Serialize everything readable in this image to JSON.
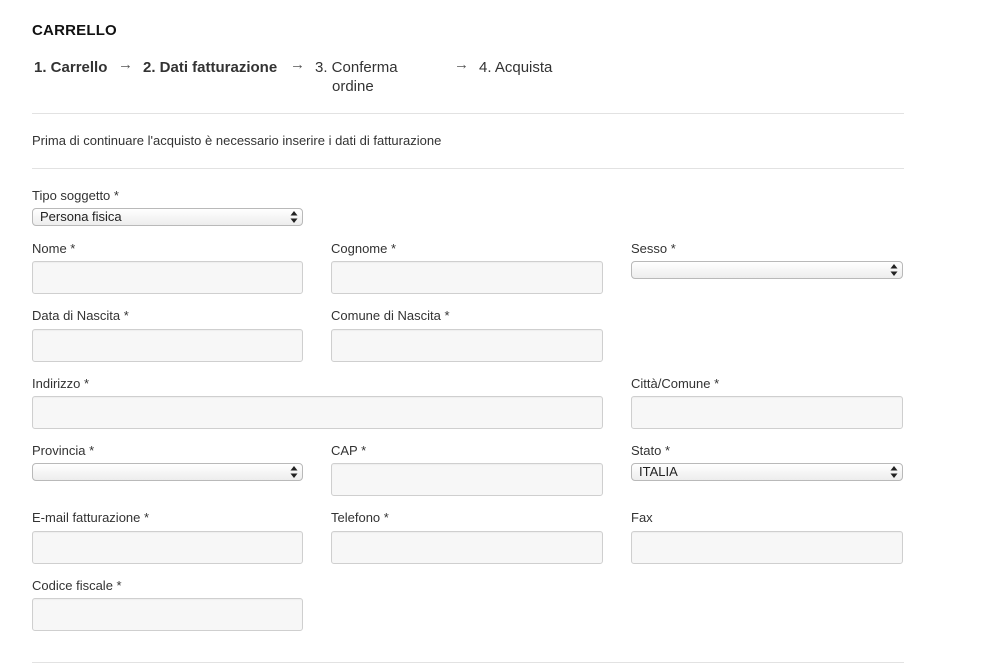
{
  "page": {
    "title": "CARRELLO"
  },
  "steps": [
    {
      "label": "1. Carrello"
    },
    {
      "label": "2. Dati fatturazione"
    },
    {
      "label_line1": "3. Conferma",
      "label_line2": "ordine"
    },
    {
      "label": "4. Acquista"
    }
  ],
  "step_arrow": "→",
  "intro_text": "Prima di continuare l'acquisto è necessario inserire i dati di fatturazione",
  "form": {
    "tipo_soggetto": {
      "label": "Tipo soggetto *",
      "value": "Persona fisica"
    },
    "nome": {
      "label": "Nome *",
      "value": ""
    },
    "cognome": {
      "label": "Cognome *",
      "value": ""
    },
    "sesso": {
      "label": "Sesso *",
      "value": ""
    },
    "data_nascita": {
      "label": "Data di Nascita *",
      "value": ""
    },
    "comune_nascita": {
      "label": "Comune di Nascita *",
      "value": ""
    },
    "indirizzo": {
      "label": "Indirizzo *",
      "value": ""
    },
    "citta": {
      "label": "Città/Comune *",
      "value": ""
    },
    "provincia": {
      "label": "Provincia *",
      "value": ""
    },
    "cap": {
      "label": "CAP *",
      "value": ""
    },
    "stato": {
      "label": "Stato *",
      "value": "ITALIA"
    },
    "email": {
      "label": "E-mail fatturazione *",
      "value": ""
    },
    "telefono": {
      "label": "Telefono *",
      "value": ""
    },
    "fax": {
      "label": "Fax",
      "value": ""
    },
    "codice_fiscale": {
      "label": "Codice fiscale *",
      "value": ""
    }
  }
}
